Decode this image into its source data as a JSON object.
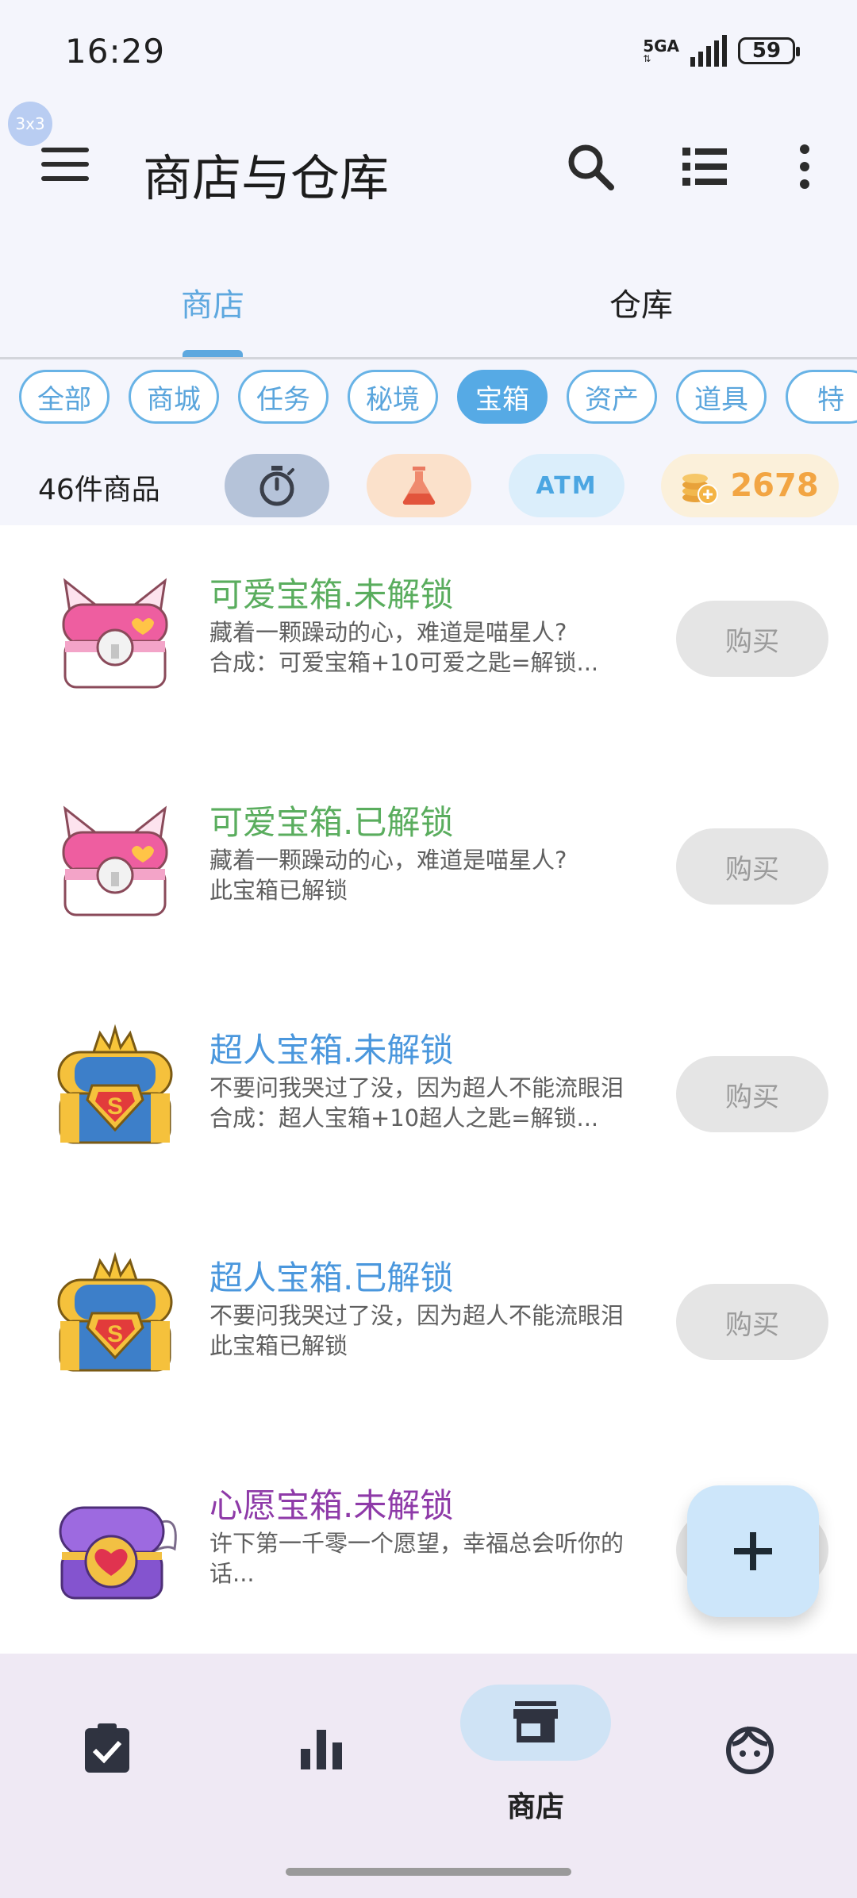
{
  "status": {
    "time": "16:29",
    "network": "5GA",
    "battery": "59"
  },
  "overlay_badge": "3x3",
  "header": {
    "title": "商店与仓库"
  },
  "tabs": [
    {
      "label": "商店",
      "active": true
    },
    {
      "label": "仓库",
      "active": false
    }
  ],
  "chips": [
    {
      "label": "全部"
    },
    {
      "label": "商城"
    },
    {
      "label": "任务"
    },
    {
      "label": "秘境"
    },
    {
      "label": "宝箱",
      "selected": true
    },
    {
      "label": "资产"
    },
    {
      "label": "道具"
    },
    {
      "label": "特"
    }
  ],
  "summary": {
    "count": "46件商品",
    "atm": "ATM",
    "coins": "2678"
  },
  "items": [
    {
      "title": "可爱宝箱.未解锁",
      "desc1": "藏着一颗躁动的心，难道是喵星人?",
      "desc2": "合成：可爱宝箱+10可爱之匙=解锁...",
      "title_color": "#5aad5e",
      "icon": "cute-chest-icon",
      "buy": "购买"
    },
    {
      "title": "可爱宝箱.已解锁",
      "desc1": "藏着一颗躁动的心，难道是喵星人?",
      "desc2": "此宝箱已解锁",
      "title_color": "#5aad5e",
      "icon": "cute-chest-icon",
      "buy": "购买"
    },
    {
      "title": "超人宝箱.未解锁",
      "desc1": "不要问我哭过了没，因为超人不能流眼泪",
      "desc2": "合成：超人宝箱+10超人之匙=解锁...",
      "title_color": "#4a97dd",
      "icon": "superman-chest-icon",
      "buy": "购买"
    },
    {
      "title": "超人宝箱.已解锁",
      "desc1": "不要问我哭过了没，因为超人不能流眼泪",
      "desc2": "此宝箱已解锁",
      "title_color": "#4a97dd",
      "icon": "superman-chest-icon",
      "buy": "购买"
    },
    {
      "title": "心愿宝箱.未解锁",
      "desc1": "许下第一千零一个愿望，幸福总会听你的",
      "desc2": "话...",
      "title_color": "#8e3aa8",
      "icon": "wish-chest-icon",
      "buy": "购买"
    }
  ],
  "bottom_nav": [
    {
      "icon": "task-clipboard-icon",
      "label": ""
    },
    {
      "icon": "stats-bar-icon",
      "label": ""
    },
    {
      "icon": "store-icon",
      "label": "商店",
      "active": true
    },
    {
      "icon": "profile-face-icon",
      "label": ""
    }
  ],
  "colors": {
    "accent": "#5ea8df",
    "chip_selected": "#56aae5",
    "coins": "#f2a543",
    "buy_bg": "#e5e5e5",
    "nav_bg": "#efe9f4"
  }
}
